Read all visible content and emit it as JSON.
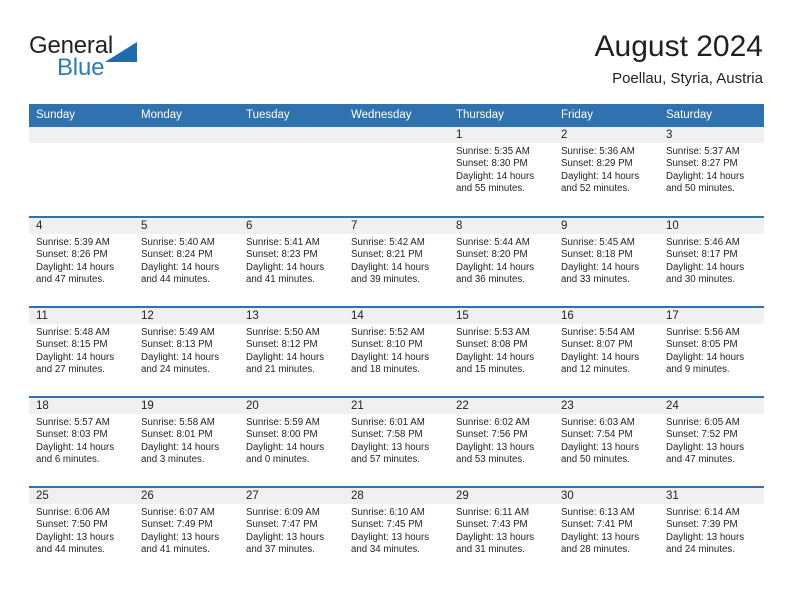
{
  "brand": {
    "word_one": "General",
    "word_two": "Blue",
    "triangle_icon": "triangle-logo-icon",
    "accent_color": "#2b7cc0",
    "header_color": "#3071b0"
  },
  "header": {
    "title": "August 2024",
    "subtitle": "Poellau, Styria, Austria"
  },
  "calendar": {
    "columns": [
      "Sunday",
      "Monday",
      "Tuesday",
      "Wednesday",
      "Thursday",
      "Friday",
      "Saturday"
    ],
    "labels": {
      "sunrise": "Sunrise:",
      "sunset": "Sunset:",
      "daylight": "Daylight:"
    },
    "weeks": [
      [
        {
          "day": "",
          "empty": true
        },
        {
          "day": "",
          "empty": true
        },
        {
          "day": "",
          "empty": true
        },
        {
          "day": "",
          "empty": true
        },
        {
          "day": "1",
          "sunrise": "Sunrise: 5:35 AM",
          "sunset": "Sunset: 8:30 PM",
          "daylight": "Daylight: 14 hours and 55 minutes."
        },
        {
          "day": "2",
          "sunrise": "Sunrise: 5:36 AM",
          "sunset": "Sunset: 8:29 PM",
          "daylight": "Daylight: 14 hours and 52 minutes."
        },
        {
          "day": "3",
          "sunrise": "Sunrise: 5:37 AM",
          "sunset": "Sunset: 8:27 PM",
          "daylight": "Daylight: 14 hours and 50 minutes."
        }
      ],
      [
        {
          "day": "4",
          "sunrise": "Sunrise: 5:39 AM",
          "sunset": "Sunset: 8:26 PM",
          "daylight": "Daylight: 14 hours and 47 minutes."
        },
        {
          "day": "5",
          "sunrise": "Sunrise: 5:40 AM",
          "sunset": "Sunset: 8:24 PM",
          "daylight": "Daylight: 14 hours and 44 minutes."
        },
        {
          "day": "6",
          "sunrise": "Sunrise: 5:41 AM",
          "sunset": "Sunset: 8:23 PM",
          "daylight": "Daylight: 14 hours and 41 minutes."
        },
        {
          "day": "7",
          "sunrise": "Sunrise: 5:42 AM",
          "sunset": "Sunset: 8:21 PM",
          "daylight": "Daylight: 14 hours and 39 minutes."
        },
        {
          "day": "8",
          "sunrise": "Sunrise: 5:44 AM",
          "sunset": "Sunset: 8:20 PM",
          "daylight": "Daylight: 14 hours and 36 minutes."
        },
        {
          "day": "9",
          "sunrise": "Sunrise: 5:45 AM",
          "sunset": "Sunset: 8:18 PM",
          "daylight": "Daylight: 14 hours and 33 minutes."
        },
        {
          "day": "10",
          "sunrise": "Sunrise: 5:46 AM",
          "sunset": "Sunset: 8:17 PM",
          "daylight": "Daylight: 14 hours and 30 minutes."
        }
      ],
      [
        {
          "day": "11",
          "sunrise": "Sunrise: 5:48 AM",
          "sunset": "Sunset: 8:15 PM",
          "daylight": "Daylight: 14 hours and 27 minutes."
        },
        {
          "day": "12",
          "sunrise": "Sunrise: 5:49 AM",
          "sunset": "Sunset: 8:13 PM",
          "daylight": "Daylight: 14 hours and 24 minutes."
        },
        {
          "day": "13",
          "sunrise": "Sunrise: 5:50 AM",
          "sunset": "Sunset: 8:12 PM",
          "daylight": "Daylight: 14 hours and 21 minutes."
        },
        {
          "day": "14",
          "sunrise": "Sunrise: 5:52 AM",
          "sunset": "Sunset: 8:10 PM",
          "daylight": "Daylight: 14 hours and 18 minutes."
        },
        {
          "day": "15",
          "sunrise": "Sunrise: 5:53 AM",
          "sunset": "Sunset: 8:08 PM",
          "daylight": "Daylight: 14 hours and 15 minutes."
        },
        {
          "day": "16",
          "sunrise": "Sunrise: 5:54 AM",
          "sunset": "Sunset: 8:07 PM",
          "daylight": "Daylight: 14 hours and 12 minutes."
        },
        {
          "day": "17",
          "sunrise": "Sunrise: 5:56 AM",
          "sunset": "Sunset: 8:05 PM",
          "daylight": "Daylight: 14 hours and 9 minutes."
        }
      ],
      [
        {
          "day": "18",
          "sunrise": "Sunrise: 5:57 AM",
          "sunset": "Sunset: 8:03 PM",
          "daylight": "Daylight: 14 hours and 6 minutes."
        },
        {
          "day": "19",
          "sunrise": "Sunrise: 5:58 AM",
          "sunset": "Sunset: 8:01 PM",
          "daylight": "Daylight: 14 hours and 3 minutes."
        },
        {
          "day": "20",
          "sunrise": "Sunrise: 5:59 AM",
          "sunset": "Sunset: 8:00 PM",
          "daylight": "Daylight: 14 hours and 0 minutes."
        },
        {
          "day": "21",
          "sunrise": "Sunrise: 6:01 AM",
          "sunset": "Sunset: 7:58 PM",
          "daylight": "Daylight: 13 hours and 57 minutes."
        },
        {
          "day": "22",
          "sunrise": "Sunrise: 6:02 AM",
          "sunset": "Sunset: 7:56 PM",
          "daylight": "Daylight: 13 hours and 53 minutes."
        },
        {
          "day": "23",
          "sunrise": "Sunrise: 6:03 AM",
          "sunset": "Sunset: 7:54 PM",
          "daylight": "Daylight: 13 hours and 50 minutes."
        },
        {
          "day": "24",
          "sunrise": "Sunrise: 6:05 AM",
          "sunset": "Sunset: 7:52 PM",
          "daylight": "Daylight: 13 hours and 47 minutes."
        }
      ],
      [
        {
          "day": "25",
          "sunrise": "Sunrise: 6:06 AM",
          "sunset": "Sunset: 7:50 PM",
          "daylight": "Daylight: 13 hours and 44 minutes."
        },
        {
          "day": "26",
          "sunrise": "Sunrise: 6:07 AM",
          "sunset": "Sunset: 7:49 PM",
          "daylight": "Daylight: 13 hours and 41 minutes."
        },
        {
          "day": "27",
          "sunrise": "Sunrise: 6:09 AM",
          "sunset": "Sunset: 7:47 PM",
          "daylight": "Daylight: 13 hours and 37 minutes."
        },
        {
          "day": "28",
          "sunrise": "Sunrise: 6:10 AM",
          "sunset": "Sunset: 7:45 PM",
          "daylight": "Daylight: 13 hours and 34 minutes."
        },
        {
          "day": "29",
          "sunrise": "Sunrise: 6:11 AM",
          "sunset": "Sunset: 7:43 PM",
          "daylight": "Daylight: 13 hours and 31 minutes."
        },
        {
          "day": "30",
          "sunrise": "Sunrise: 6:13 AM",
          "sunset": "Sunset: 7:41 PM",
          "daylight": "Daylight: 13 hours and 28 minutes."
        },
        {
          "day": "31",
          "sunrise": "Sunrise: 6:14 AM",
          "sunset": "Sunset: 7:39 PM",
          "daylight": "Daylight: 13 hours and 24 minutes."
        }
      ]
    ]
  }
}
